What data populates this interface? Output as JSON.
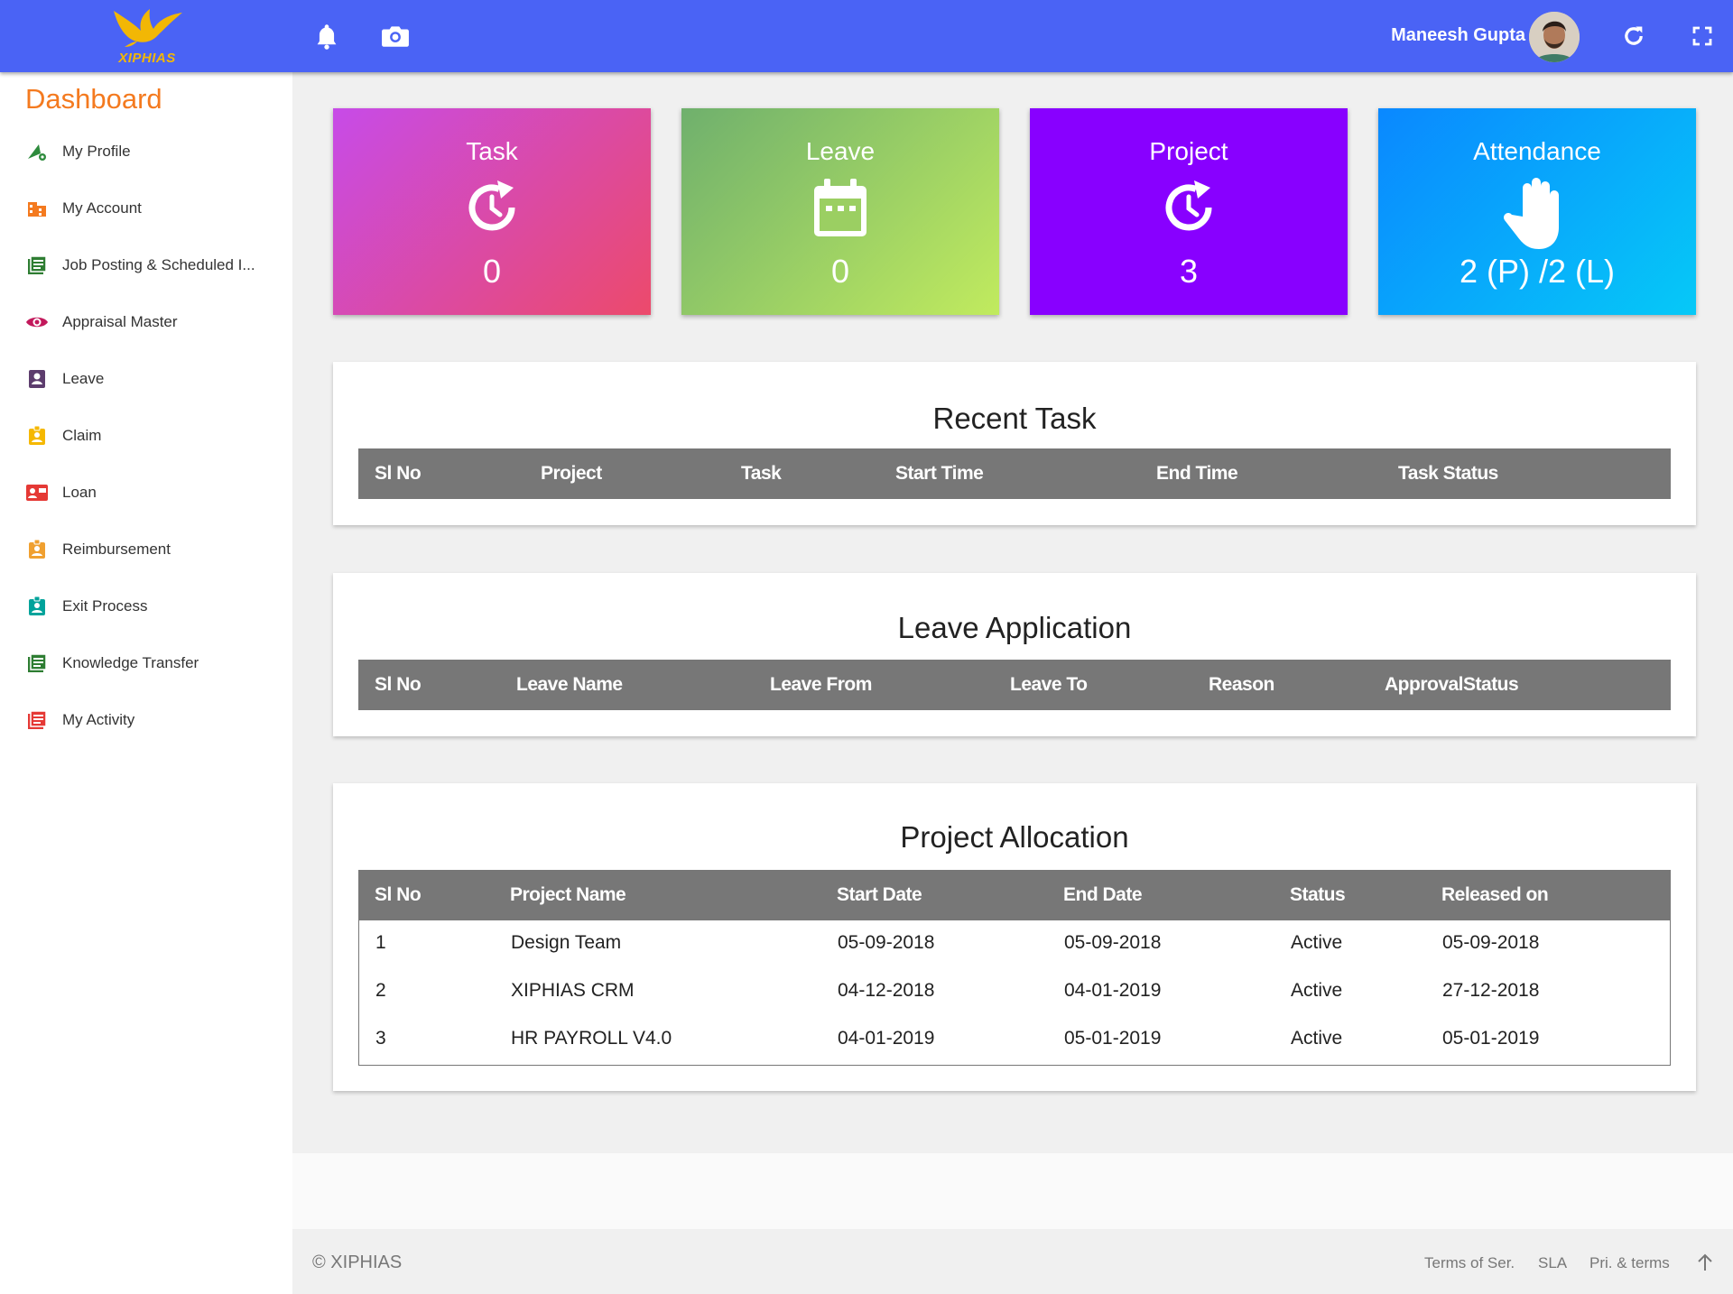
{
  "header": {
    "logo_text": "XIPHIAS",
    "user_name": "Maneesh Gupta",
    "icons": [
      "bell-icon",
      "camera-icon",
      "refresh-icon",
      "fullscreen-icon"
    ]
  },
  "sidebar": {
    "title": "Dashboard",
    "items": [
      {
        "label": "My Profile",
        "icon": "profile-settings-icon",
        "color": "#2e8b3d"
      },
      {
        "label": "My Account",
        "icon": "building-icon",
        "color": "#f47a1f"
      },
      {
        "label": "Job Posting & Scheduled I...",
        "icon": "list-icon",
        "color": "#2e7d32"
      },
      {
        "label": "Appraisal Master",
        "icon": "eye-icon",
        "color": "#c2185b"
      },
      {
        "label": "Leave",
        "icon": "contact-card-icon",
        "color": "#5d3d6e"
      },
      {
        "label": "Claim",
        "icon": "badge-icon",
        "color": "#f5b800"
      },
      {
        "label": "Loan",
        "icon": "contact-mail-icon",
        "color": "#e53935"
      },
      {
        "label": "Reimbursement",
        "icon": "badge-icon",
        "color": "#f0a030"
      },
      {
        "label": "Exit Process",
        "icon": "badge-icon",
        "color": "#00a39b"
      },
      {
        "label": "Knowledge Transfer",
        "icon": "list-icon",
        "color": "#2e7d32"
      },
      {
        "label": "My Activity",
        "icon": "list-icon",
        "color": "#e53935"
      }
    ]
  },
  "cards": [
    {
      "title": "Task",
      "value": "0",
      "icon": "history-icon",
      "gradient": [
        "#c74be8",
        "#ec4a6b"
      ]
    },
    {
      "title": "Leave",
      "value": "0",
      "icon": "calendar-icon",
      "gradient": [
        "#6fb06d",
        "#c1eb5e"
      ]
    },
    {
      "title": "Project",
      "value": "3",
      "icon": "history-icon",
      "gradient": [
        "#8800ff",
        "#8800ff"
      ]
    },
    {
      "title": "Attendance",
      "value": "2 (P) /2 (L)",
      "icon": "hand-icon",
      "gradient": [
        "#0a88ff",
        "#06c9f7"
      ]
    }
  ],
  "recent_task": {
    "title": "Recent Task",
    "columns": [
      "Sl No",
      "Project",
      "Task",
      "Start Time",
      "End Time",
      "Task Status"
    ]
  },
  "leave_application": {
    "title": "Leave Application",
    "columns": [
      "Sl No",
      "Leave Name",
      "Leave From",
      "Leave To",
      "Reason",
      "ApprovalStatus"
    ]
  },
  "project_allocation": {
    "title": "Project Allocation",
    "columns": [
      "Sl No",
      "Project Name",
      "Start Date",
      "End Date",
      "Status",
      "Released on"
    ],
    "rows": [
      [
        "1",
        "Design Team",
        "05-09-2018",
        "05-09-2018",
        "Active",
        "05-09-2018"
      ],
      [
        "2",
        "XIPHIAS CRM",
        "04-12-2018",
        "04-01-2019",
        "Active",
        "27-12-2018"
      ],
      [
        "3",
        "HR PAYROLL V4.0",
        "04-01-2019",
        "05-01-2019",
        "Active",
        "05-01-2019"
      ]
    ]
  },
  "footer": {
    "copyright": "© XIPHIAS",
    "links": [
      "Terms of Ser.",
      "SLA",
      "Pri. & terms"
    ]
  }
}
